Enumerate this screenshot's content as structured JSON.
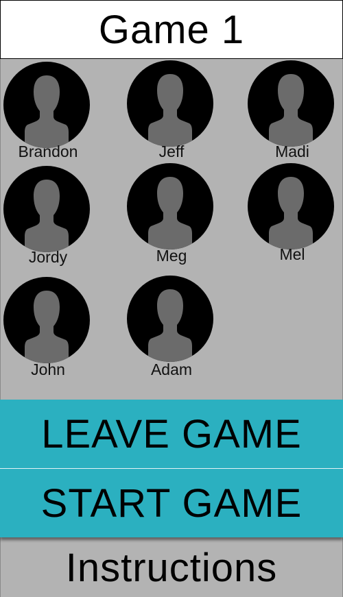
{
  "header": {
    "title": "Game 1"
  },
  "players": [
    {
      "name": "Brandon",
      "icon": "person-silhouette-icon"
    },
    {
      "name": "Jeff",
      "icon": "person-silhouette-icon"
    },
    {
      "name": "Madi",
      "icon": "person-silhouette-icon"
    },
    {
      "name": "Jordy",
      "icon": "person-silhouette-icon"
    },
    {
      "name": "Meg",
      "icon": "person-silhouette-icon"
    },
    {
      "name": "Mel",
      "icon": "person-silhouette-icon"
    },
    {
      "name": "John",
      "icon": "person-silhouette-icon"
    },
    {
      "name": "Adam",
      "icon": "person-silhouette-icon"
    }
  ],
  "actions": {
    "leave_label": "LEAVE GAME",
    "start_label": "START GAME",
    "instructions_label": "Instructions"
  },
  "colors": {
    "background": "#b3b3b3",
    "button": "#2bb0c0",
    "avatar_bg": "#000000",
    "silhouette": "#6b6b6b"
  }
}
